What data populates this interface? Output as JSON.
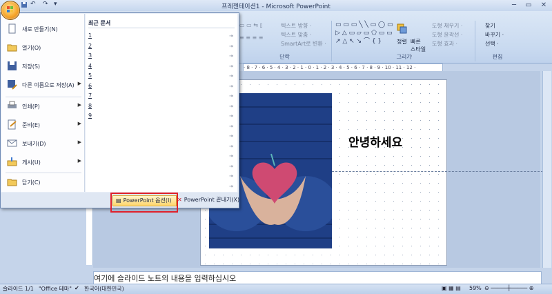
{
  "window": {
    "title": "프레젠테이션1 - Microsoft PowerPoint",
    "minimize": "─",
    "restore": "▭",
    "close": "✕"
  },
  "quick_access": {
    "save_icon": "save-icon",
    "undo_icon": "undo-icon",
    "redo_icon": "redo-icon",
    "customize": "▾"
  },
  "ribbon": {
    "groups": {
      "paragraph": {
        "label": "단락",
        "items": [
          "텍스트 방향 ·",
          "텍스트 맞춤 ·",
          "SmartArt로 변환 ·"
        ]
      },
      "drawing": {
        "label": "그리기",
        "arrange": "정렬",
        "quick_styles": "빠른 스타일 ·",
        "items": [
          "도형 채우기 ·",
          "도형 윤곽선 ·",
          "도형 효과 ·"
        ]
      },
      "editing": {
        "label": "편집",
        "items": [
          "찾기",
          "바꾸기 ·",
          "선택 ·"
        ]
      }
    }
  },
  "ruler": {
    "text": "· 8 · 7 · 6 · 5 · 4 · 3 · 2 · 1 · 0 · 1 · 2 · 3 · 4 · 5 · 6 · 7 · 8 · 9 · 10 · 11 · 12 ·"
  },
  "slide": {
    "title_text": "안녕하세요"
  },
  "notes": {
    "placeholder": "여기에 슬라이드 노트의 내용을 입력하십시오"
  },
  "status_bar": {
    "slide_info": "슬라이드 1/1",
    "theme": "\"Office 테마\"",
    "language": "한국어(대한민국)",
    "zoom": "59%"
  },
  "office_menu": {
    "items": [
      {
        "label": "새로 만들기(N)",
        "icon": "new-document-icon",
        "arrow": false
      },
      {
        "label": "열기(O)",
        "icon": "open-folder-icon",
        "arrow": false
      },
      {
        "label": "저장(S)",
        "icon": "save-disk-icon",
        "arrow": false
      },
      {
        "label": "다른 이름으로 저장(A)",
        "icon": "save-as-icon",
        "arrow": true
      },
      {
        "label": "인쇄(P)",
        "icon": "print-icon",
        "arrow": true
      },
      {
        "label": "준비(E)",
        "icon": "prepare-icon",
        "arrow": true
      },
      {
        "label": "보내기(D)",
        "icon": "send-icon",
        "arrow": true
      },
      {
        "label": "게시(U)",
        "icon": "publish-icon",
        "arrow": true
      },
      {
        "label": "닫기(C)",
        "icon": "close-folder-icon",
        "arrow": false
      }
    ],
    "recent_title": "최근 문서",
    "recent_numbers": [
      "1",
      "2",
      "3",
      "4",
      "5",
      "6",
      "7",
      "8",
      "9"
    ],
    "options_button": "PowerPoint 옵션(I)",
    "exit_button": "PowerPoint 끝내기(X)"
  }
}
